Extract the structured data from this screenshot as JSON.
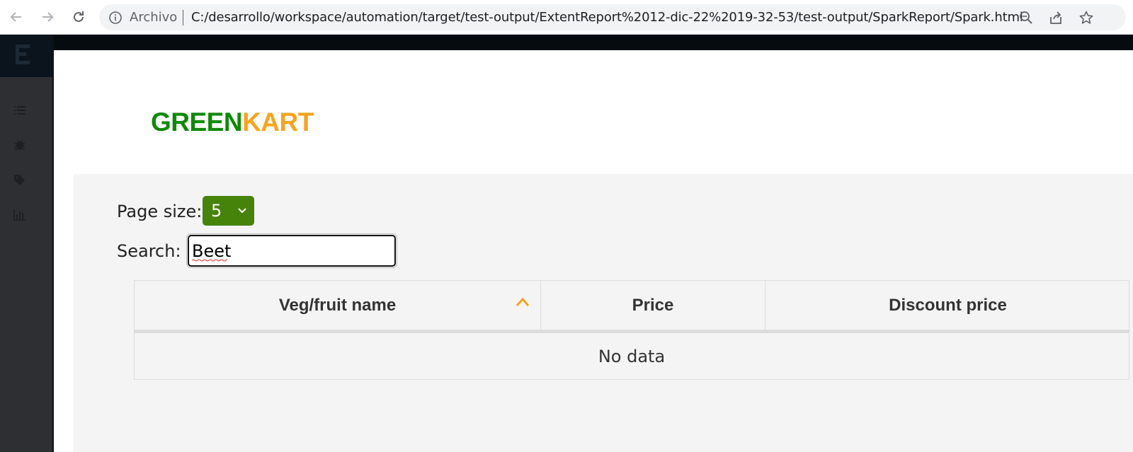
{
  "browser": {
    "scheme_label": "Archivo",
    "url": "C:/desarrollo/workspace/automation/target/test-output/ExtentReport%2012-dic-22%2019-32-53/test-output/SparkReport/Spark.html",
    "icons": [
      "back-icon",
      "forward-icon",
      "reload-icon",
      "info-icon",
      "zoom-icon",
      "share-icon",
      "bookmark-star-icon"
    ]
  },
  "sidebar": {
    "items": [
      {
        "name": "list-icon"
      },
      {
        "name": "bug-icon"
      },
      {
        "name": "tag-icon"
      },
      {
        "name": "bar-chart-icon"
      }
    ]
  },
  "brand": {
    "part1": "GREEN",
    "part2": "KART",
    "color1": "#0d8a05",
    "color2": "#f9a31a"
  },
  "controls": {
    "page_size_label": "Page size:",
    "page_size_value": "5",
    "search_label": "Search:",
    "search_value": "Beet"
  },
  "table": {
    "columns": [
      "Veg/fruit name",
      "Price",
      "Discount price"
    ],
    "sorted_column": "Veg/fruit name",
    "sort_direction": "ascending",
    "empty_text": "No data"
  }
}
